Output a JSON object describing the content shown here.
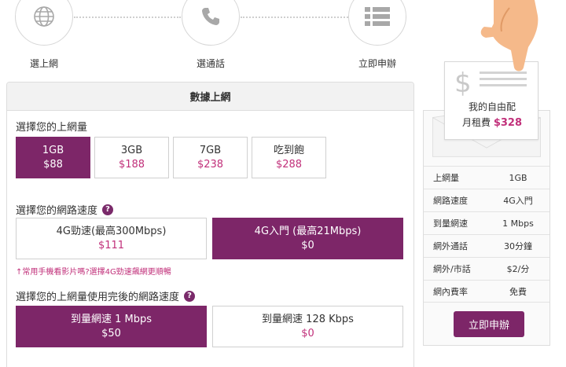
{
  "steps": [
    {
      "label": "選上網",
      "icon": "globe-icon"
    },
    {
      "label": "選通話",
      "icon": "phone-icon"
    },
    {
      "label": "立即申辦",
      "icon": "list-icon"
    }
  ],
  "panel": {
    "title": "數據上網",
    "q1": "選擇您的上網量",
    "data_options": [
      {
        "name": "1GB",
        "price": "$88",
        "selected": true
      },
      {
        "name": "3GB",
        "price": "$188",
        "selected": false
      },
      {
        "name": "7GB",
        "price": "$238",
        "selected": false
      },
      {
        "name": "吃到飽",
        "price": "$288",
        "selected": false
      }
    ],
    "q2": "選擇您的網路速度",
    "speed_options": [
      {
        "name": "4G勁速(最高300Mbps)",
        "price": "$111",
        "selected": false
      },
      {
        "name": "4G入門 (最高21Mbps)",
        "price": "$0",
        "selected": true
      }
    ],
    "note": "↑常用手機看影片嗎?選擇4G勁速飆網更順暢",
    "q3": "選擇您的上網量使用完後的網路速度",
    "after_options": [
      {
        "name": "到量網速 1 Mbps",
        "price": "$50",
        "selected": true
      },
      {
        "name": "到量網速 128 Kbps",
        "price": "$0",
        "selected": false
      }
    ],
    "help_glyph": "?"
  },
  "card": {
    "title": "我的自由配",
    "rent_label": "月租費",
    "rent_amount": "$328",
    "dollar": "$"
  },
  "summary": {
    "rows": [
      {
        "k": "上網量",
        "v": "1GB"
      },
      {
        "k": "網路速度",
        "v": "4G入門"
      },
      {
        "k": "到量網速",
        "v": "1 Mbps"
      },
      {
        "k": "網外通話",
        "v": "30分鐘"
      },
      {
        "k": "網外/市話",
        "v": "$2/分"
      },
      {
        "k": "網內費率",
        "v": "免費"
      }
    ],
    "apply_label": "立即申辦"
  },
  "colors": {
    "accent": "#7d2668",
    "price": "#c1307a"
  }
}
